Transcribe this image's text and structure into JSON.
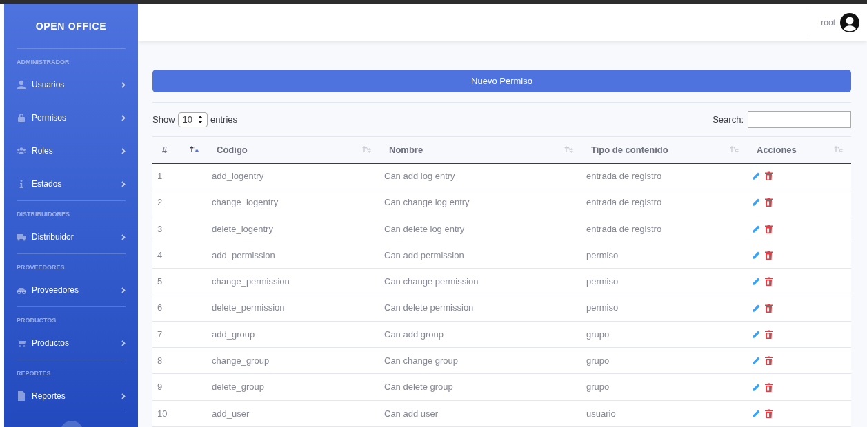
{
  "sidebar": {
    "brand": "OPEN OFFICE",
    "groups": [
      {
        "heading": "ADMINISTRADOR",
        "items": [
          {
            "label": "Usuarios",
            "kind": "user"
          },
          {
            "label": "Permisos",
            "kind": "lock"
          },
          {
            "label": "Roles",
            "kind": "users"
          },
          {
            "label": "Estados",
            "kind": "info"
          }
        ]
      },
      {
        "heading": "DISTRIBUIDORES",
        "items": [
          {
            "label": "Distribuidor",
            "kind": "truck"
          }
        ]
      },
      {
        "heading": "PROVEEDORES",
        "items": [
          {
            "label": "Proveedores",
            "kind": "car"
          }
        ]
      },
      {
        "heading": "PRODUCTOS",
        "items": [
          {
            "label": "Productos",
            "kind": "cart"
          }
        ]
      },
      {
        "heading": "REPORTES",
        "items": [
          {
            "label": "Reportes",
            "kind": "file"
          }
        ]
      }
    ]
  },
  "topbar": {
    "user": "root"
  },
  "new_button": "Nuevo Permiso",
  "length_control": {
    "before": "Show",
    "value": "10",
    "after": "entries"
  },
  "search": {
    "label": "Search:"
  },
  "table": {
    "columns": [
      {
        "label": "#",
        "sorted": true
      },
      {
        "label": "Código",
        "sorted": false
      },
      {
        "label": "Nombre",
        "sorted": false
      },
      {
        "label": "Tipo de contenido",
        "sorted": false
      },
      {
        "label": "Acciones",
        "sorted": false
      }
    ],
    "rows": [
      [
        "1",
        "add_logentry",
        "Can add log entry",
        "entrada de registro"
      ],
      [
        "2",
        "change_logentry",
        "Can change log entry",
        "entrada de registro"
      ],
      [
        "3",
        "delete_logentry",
        "Can delete log entry",
        "entrada de registro"
      ],
      [
        "4",
        "add_permission",
        "Can add permission",
        "permiso"
      ],
      [
        "5",
        "change_permission",
        "Can change permission",
        "permiso"
      ],
      [
        "6",
        "delete_permission",
        "Can delete permission",
        "permiso"
      ],
      [
        "7",
        "add_group",
        "Can add group",
        "grupo"
      ],
      [
        "8",
        "change_group",
        "Can change group",
        "grupo"
      ],
      [
        "9",
        "delete_group",
        "Can delete group",
        "grupo"
      ],
      [
        "10",
        "add_user",
        "Can add user",
        "usuario"
      ]
    ]
  }
}
